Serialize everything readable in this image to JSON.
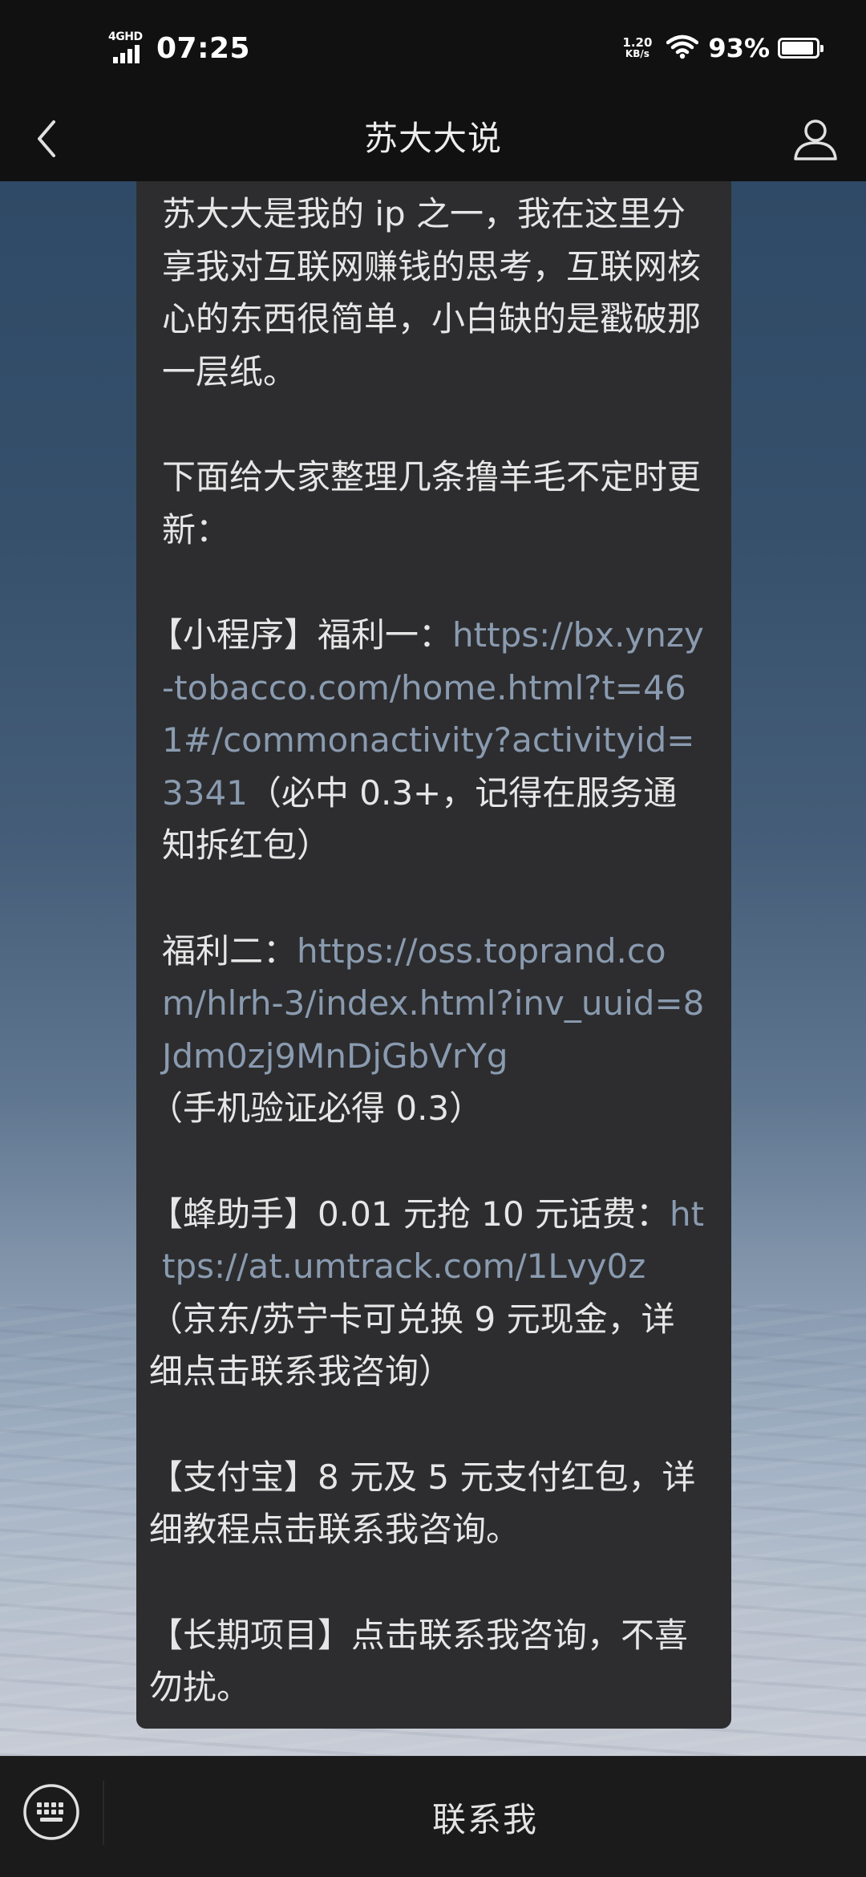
{
  "status_bar": {
    "network_type": "4GHD",
    "time": "07:25",
    "net_speed_value": "1.20",
    "net_speed_unit": "KB/s",
    "battery_percent": "93%",
    "battery_level": 0.93
  },
  "nav": {
    "title": "苏大大说",
    "back_icon": "chevron-left-icon",
    "profile_icon": "person-icon"
  },
  "message": {
    "intro": "苏大大是我的 ip 之一，我在这里分享我对互联网赚钱的思考，互联网核心的东西很简单，小白缺的是戳破那一层纸。",
    "subtitle": "下面给大家整理几条撸羊毛不定时更新：",
    "items": [
      {
        "prefix": "【小程序】福利一：",
        "link": "https://bx.ynzy-tobacco.com/home.html?t=461#/commonactivity?activityid=3341",
        "suffix": "（必中 0.3+，记得在服务通知拆红包）"
      },
      {
        "prefix": "福利二：",
        "link": "https://oss.toprand.com/hlrh-3/index.html?inv_uuid=8Jdm0zj9MnDjGbVrYg",
        "suffix": "（手机验证必得 0.3）"
      },
      {
        "prefix": "【蜂助手】0.01 元抢 10 元话费：",
        "link": "https://at.umtrack.com/1Lvy0z",
        "suffix": "（京东/苏宁卡可兑换 9 元现金，详细点击联系我咨询）"
      }
    ],
    "alipay": "【支付宝】8 元及 5 元支付红包，详细教程点击联系我咨询。",
    "long_term": "【长期项目】点击联系我咨询，不喜勿扰。"
  },
  "bottom_bar": {
    "keyboard_icon": "keyboard-icon",
    "contact_label": "联系我"
  },
  "colors": {
    "link": "#8a9bb0",
    "card": "#2d2d2f",
    "bar": "#111111"
  }
}
